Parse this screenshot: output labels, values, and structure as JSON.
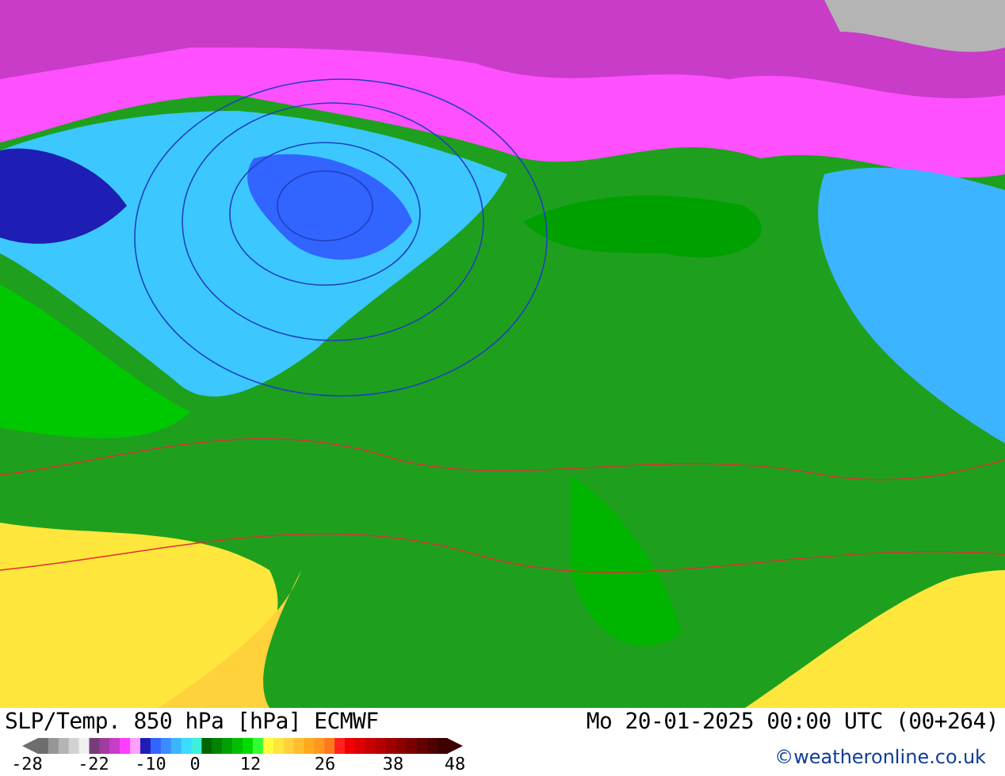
{
  "map": {
    "title": "SLP/Temp. 850 hPa [hPa] ECMWF",
    "valid_time": "Mo 20-01-2025 00:00 UTC (00+264)",
    "credit": "©weatheronline.co.uk"
  },
  "legend": {
    "swatches": [
      {
        "color": "#6e6e6e"
      },
      {
        "color": "#969696"
      },
      {
        "color": "#b4b4b4"
      },
      {
        "color": "#d2d2d2"
      },
      {
        "color": "#f0f0f0"
      },
      {
        "color": "#783c78"
      },
      {
        "color": "#a03ca0"
      },
      {
        "color": "#c83cc8"
      },
      {
        "color": "#ff3cff"
      },
      {
        "color": "#ffa0ff"
      },
      {
        "color": "#1e1eb4"
      },
      {
        "color": "#3264ff"
      },
      {
        "color": "#3c8cff"
      },
      {
        "color": "#3cb4ff"
      },
      {
        "color": "#3cdcff"
      },
      {
        "color": "#3cf0dc"
      },
      {
        "color": "#006400"
      },
      {
        "color": "#008200"
      },
      {
        "color": "#00a000"
      },
      {
        "color": "#00be00"
      },
      {
        "color": "#00dc00"
      },
      {
        "color": "#32ff32"
      },
      {
        "color": "#ffff3c"
      },
      {
        "color": "#ffe63c"
      },
      {
        "color": "#ffd23c"
      },
      {
        "color": "#ffbe32"
      },
      {
        "color": "#ffaa1e"
      },
      {
        "color": "#ff961e"
      },
      {
        "color": "#ff781e"
      },
      {
        "color": "#ff2020"
      },
      {
        "color": "#f00000"
      },
      {
        "color": "#dc0000"
      },
      {
        "color": "#c80000"
      },
      {
        "color": "#b40000"
      },
      {
        "color": "#a00000"
      },
      {
        "color": "#8c0000"
      },
      {
        "color": "#780000"
      },
      {
        "color": "#640000"
      },
      {
        "color": "#500000"
      },
      {
        "color": "#3c0000"
      }
    ],
    "ticks": [
      "-28",
      "-22",
      "-10",
      "0",
      "12",
      "26",
      "38",
      "48"
    ]
  }
}
